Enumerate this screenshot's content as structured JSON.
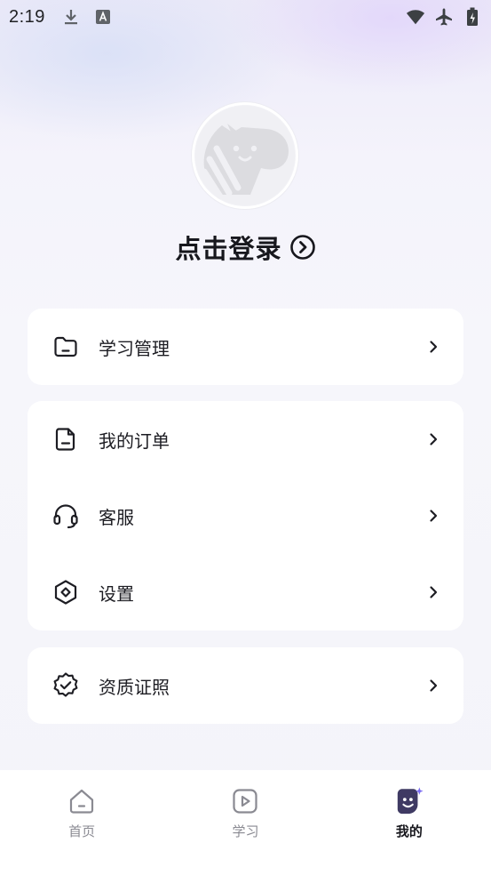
{
  "status_bar": {
    "time": "2:19",
    "icons": [
      "download-icon",
      "font-a-icon",
      "wifi-icon",
      "airplane-icon",
      "battery-icon"
    ]
  },
  "profile": {
    "avatar_icon": "zebra-mascot-icon",
    "login_label": "点击登录"
  },
  "menu": {
    "group1": [
      {
        "label": "学习管理",
        "icon": "folder-icon"
      }
    ],
    "group2": [
      {
        "label": "我的订单",
        "icon": "document-icon"
      },
      {
        "label": "客服",
        "icon": "headset-icon"
      },
      {
        "label": "设置",
        "icon": "settings-hex-icon"
      }
    ],
    "group3": [
      {
        "label": "资质证照",
        "icon": "verified-badge-icon"
      }
    ]
  },
  "bottom_nav": {
    "items": [
      {
        "label": "首页",
        "icon": "home-icon",
        "active": false
      },
      {
        "label": "学习",
        "icon": "play-icon",
        "active": false
      },
      {
        "label": "我的",
        "icon": "mine-face-icon",
        "active": true
      }
    ]
  },
  "colors": {
    "accent": "#3f3a63",
    "sparkle": "#7b6cf2",
    "text_primary": "#17171d",
    "text_muted": "#8a8a92"
  }
}
